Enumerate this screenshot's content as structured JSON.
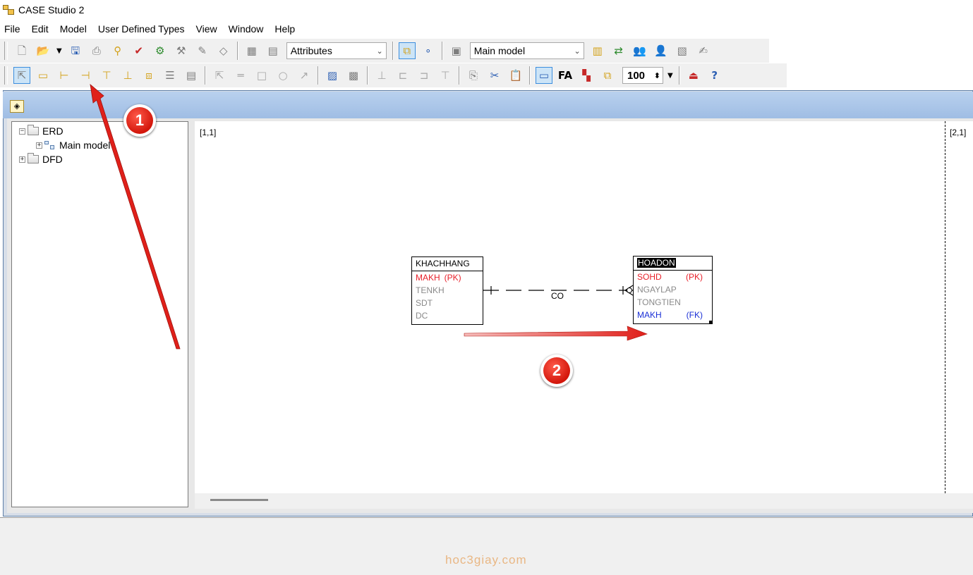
{
  "window": {
    "title": "CASE Studio 2"
  },
  "menu": [
    "File",
    "Edit",
    "Model",
    "User Defined Types",
    "View",
    "Window",
    "Help"
  ],
  "toolbar1": {
    "attributes_combo": "Attributes",
    "model_combo": "Main model"
  },
  "toolbar2": {
    "zoom_value": "100"
  },
  "tree": {
    "erd": "ERD",
    "main_model": "Main model",
    "dfd": "DFD"
  },
  "canvas": {
    "page1_label": "[1,1]",
    "page2_label": "[2,1]"
  },
  "entities": {
    "khachhang": {
      "name": "KHACHHANG",
      "attrs": [
        {
          "name": "MAKH",
          "key": "(PK)",
          "role": "pk"
        },
        {
          "name": "TENKH",
          "key": "",
          "role": "normal"
        },
        {
          "name": "SDT",
          "key": "",
          "role": "normal"
        },
        {
          "name": "DC",
          "key": "",
          "role": "normal"
        }
      ]
    },
    "hoadon": {
      "name": "HOADON",
      "attrs": [
        {
          "name": "SOHD",
          "key": "(PK)",
          "role": "pk"
        },
        {
          "name": "NGAYLAP",
          "key": "",
          "role": "normal"
        },
        {
          "name": "TONGTIEN",
          "key": "",
          "role": "normal"
        },
        {
          "name": "MAKH",
          "key": "(FK)",
          "role": "fk"
        }
      ]
    }
  },
  "relationship": {
    "label": "CO"
  },
  "annotations": {
    "badge1": "1",
    "badge2": "2"
  },
  "watermark": "hoc3giay.com",
  "colors": {
    "pk": "#e8202a",
    "fk": "#1a2fd6",
    "normal_attr": "#8a8a8a",
    "arrow": "#e0201a",
    "accent": "#3c8ede"
  }
}
